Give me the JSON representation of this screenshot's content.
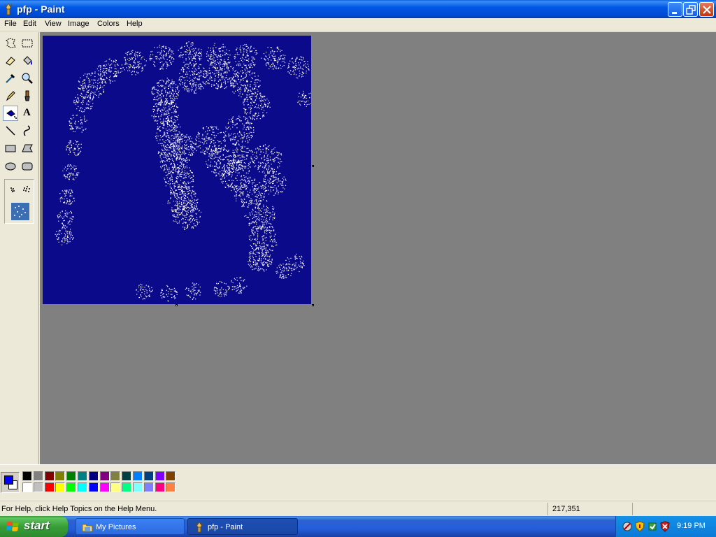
{
  "window": {
    "title": "pfp - Paint"
  },
  "menu": [
    "File",
    "Edit",
    "View",
    "Image",
    "Colors",
    "Help"
  ],
  "tools": [
    {
      "name": "free-form-select-tool"
    },
    {
      "name": "select-tool"
    },
    {
      "name": "eraser-tool"
    },
    {
      "name": "fill-with-color-tool"
    },
    {
      "name": "pick-color-tool"
    },
    {
      "name": "magnifier-tool"
    },
    {
      "name": "pencil-tool"
    },
    {
      "name": "brush-tool"
    },
    {
      "name": "airbrush-tool",
      "active": true
    },
    {
      "name": "text-tool"
    },
    {
      "name": "line-tool"
    },
    {
      "name": "curve-tool"
    },
    {
      "name": "rectangle-tool"
    },
    {
      "name": "polygon-tool"
    },
    {
      "name": "ellipse-tool"
    },
    {
      "name": "rounded-rectangle-tool"
    }
  ],
  "text_tool_glyph": "A",
  "canvas": {
    "background_color": "#0a0a8a",
    "spray_color": "#ffffff"
  },
  "current_colors": {
    "foreground": "#0000ff",
    "background": "#ffffff"
  },
  "palette_top": [
    "#000000",
    "#808080",
    "#800000",
    "#808000",
    "#008000",
    "#008080",
    "#000080",
    "#800080",
    "#808040",
    "#004040",
    "#0080ff",
    "#004080",
    "#8000ff",
    "#804000"
  ],
  "palette_bottom": [
    "#ffffff",
    "#c0c0c0",
    "#ff0000",
    "#ffff00",
    "#00ff00",
    "#00ffff",
    "#0000ff",
    "#ff00ff",
    "#ffff80",
    "#00ff80",
    "#80ffff",
    "#8080ff",
    "#ff0080",
    "#ff8040"
  ],
  "status": {
    "help_text": "For Help, click Help Topics on the Help Menu.",
    "coordinates": "217,351"
  },
  "taskbar": {
    "start_label": "start",
    "tasks": [
      {
        "label": "My Pictures",
        "active": false
      },
      {
        "label": "pfp - Paint",
        "active": true
      }
    ],
    "clock": "9:19 PM"
  }
}
